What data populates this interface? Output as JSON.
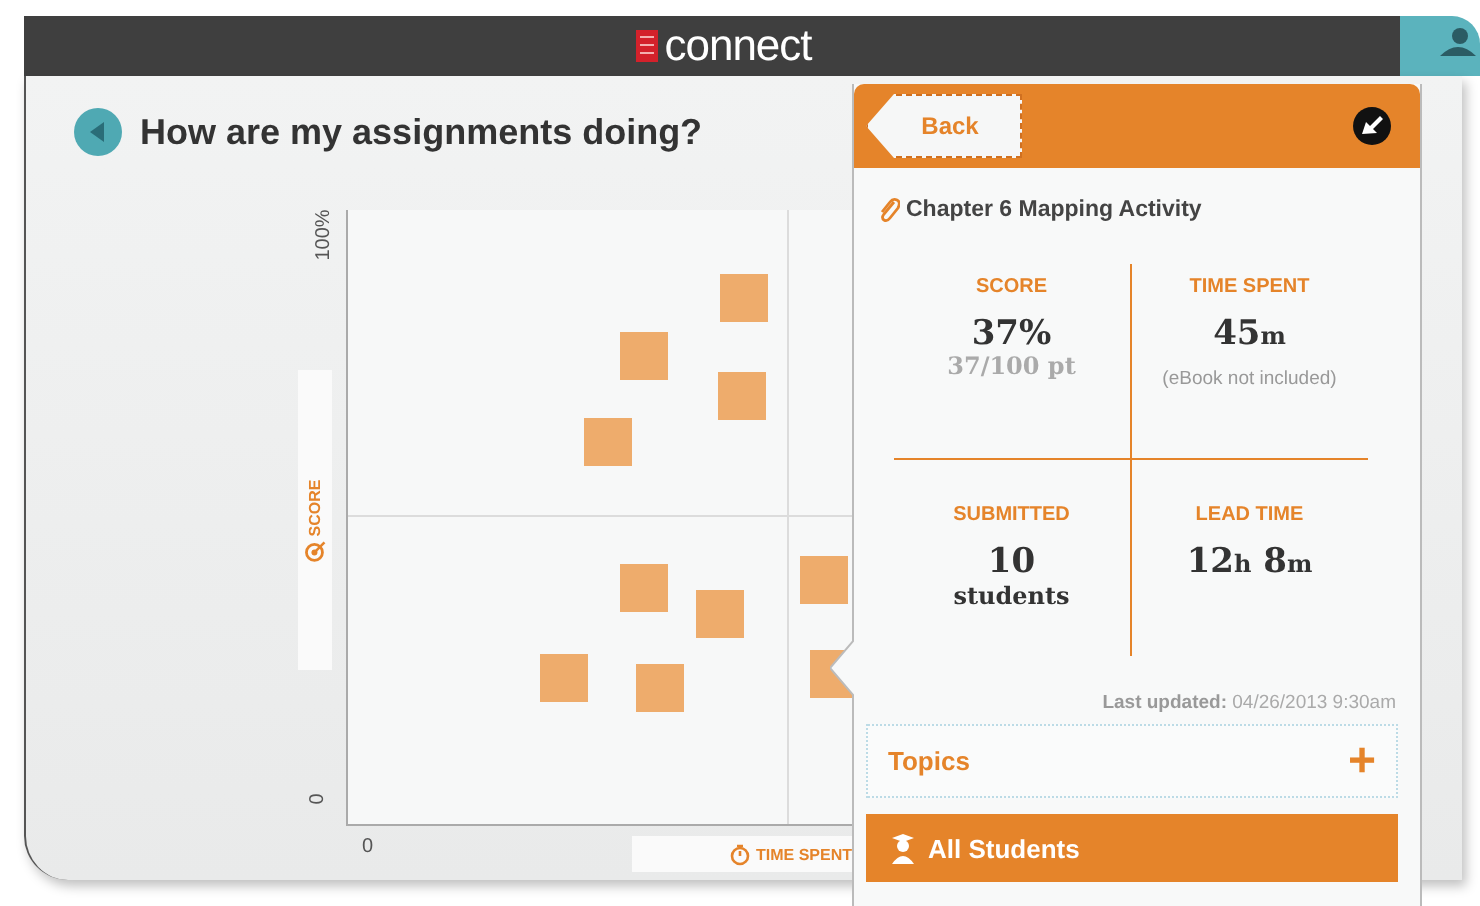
{
  "header": {
    "logo_text": "connect"
  },
  "page": {
    "title": "How are my assignments doing?"
  },
  "chart": {
    "y_axis_label": "SCORE",
    "y_ticks": [
      "100%",
      "0"
    ],
    "x_ticks": [
      "0"
    ],
    "x_axis_label": "TIME SPENT"
  },
  "detail_panel": {
    "back_button": "Back",
    "title": "Chapter 6 Mapping Activity",
    "stats": [
      {
        "label": "SCORE",
        "value": [
          {
            "text": "37%",
            "kind": "number"
          }
        ],
        "note": {
          "text": "37/100 pt",
          "kind": "muted"
        }
      },
      {
        "label": "TIME SPENT",
        "value": [
          {
            "text": "45",
            "kind": "number"
          },
          {
            "text": "m",
            "kind": "unit"
          }
        ],
        "note": {
          "text": "(eBook not included)",
          "kind": "small"
        }
      },
      {
        "label": "SUBMITTED",
        "value": [
          {
            "text": "10",
            "kind": "number"
          }
        ],
        "note": {
          "text": "students",
          "kind": "strong"
        }
      },
      {
        "label": "LEAD TIME",
        "value": [
          {
            "text": "12",
            "kind": "number"
          },
          {
            "text": "h",
            "kind": "unit"
          },
          {
            "text": " 8",
            "kind": "number"
          },
          {
            "text": "m",
            "kind": "unit"
          }
        ]
      }
    ],
    "last_updated_label": "Last updated:",
    "last_updated_value": "04/26/2013 9:30am",
    "sections": [
      {
        "label": "Topics",
        "kind": "collapsible",
        "expand_symbol": "+"
      },
      {
        "label": "All Students",
        "kind": "header"
      }
    ]
  }
}
